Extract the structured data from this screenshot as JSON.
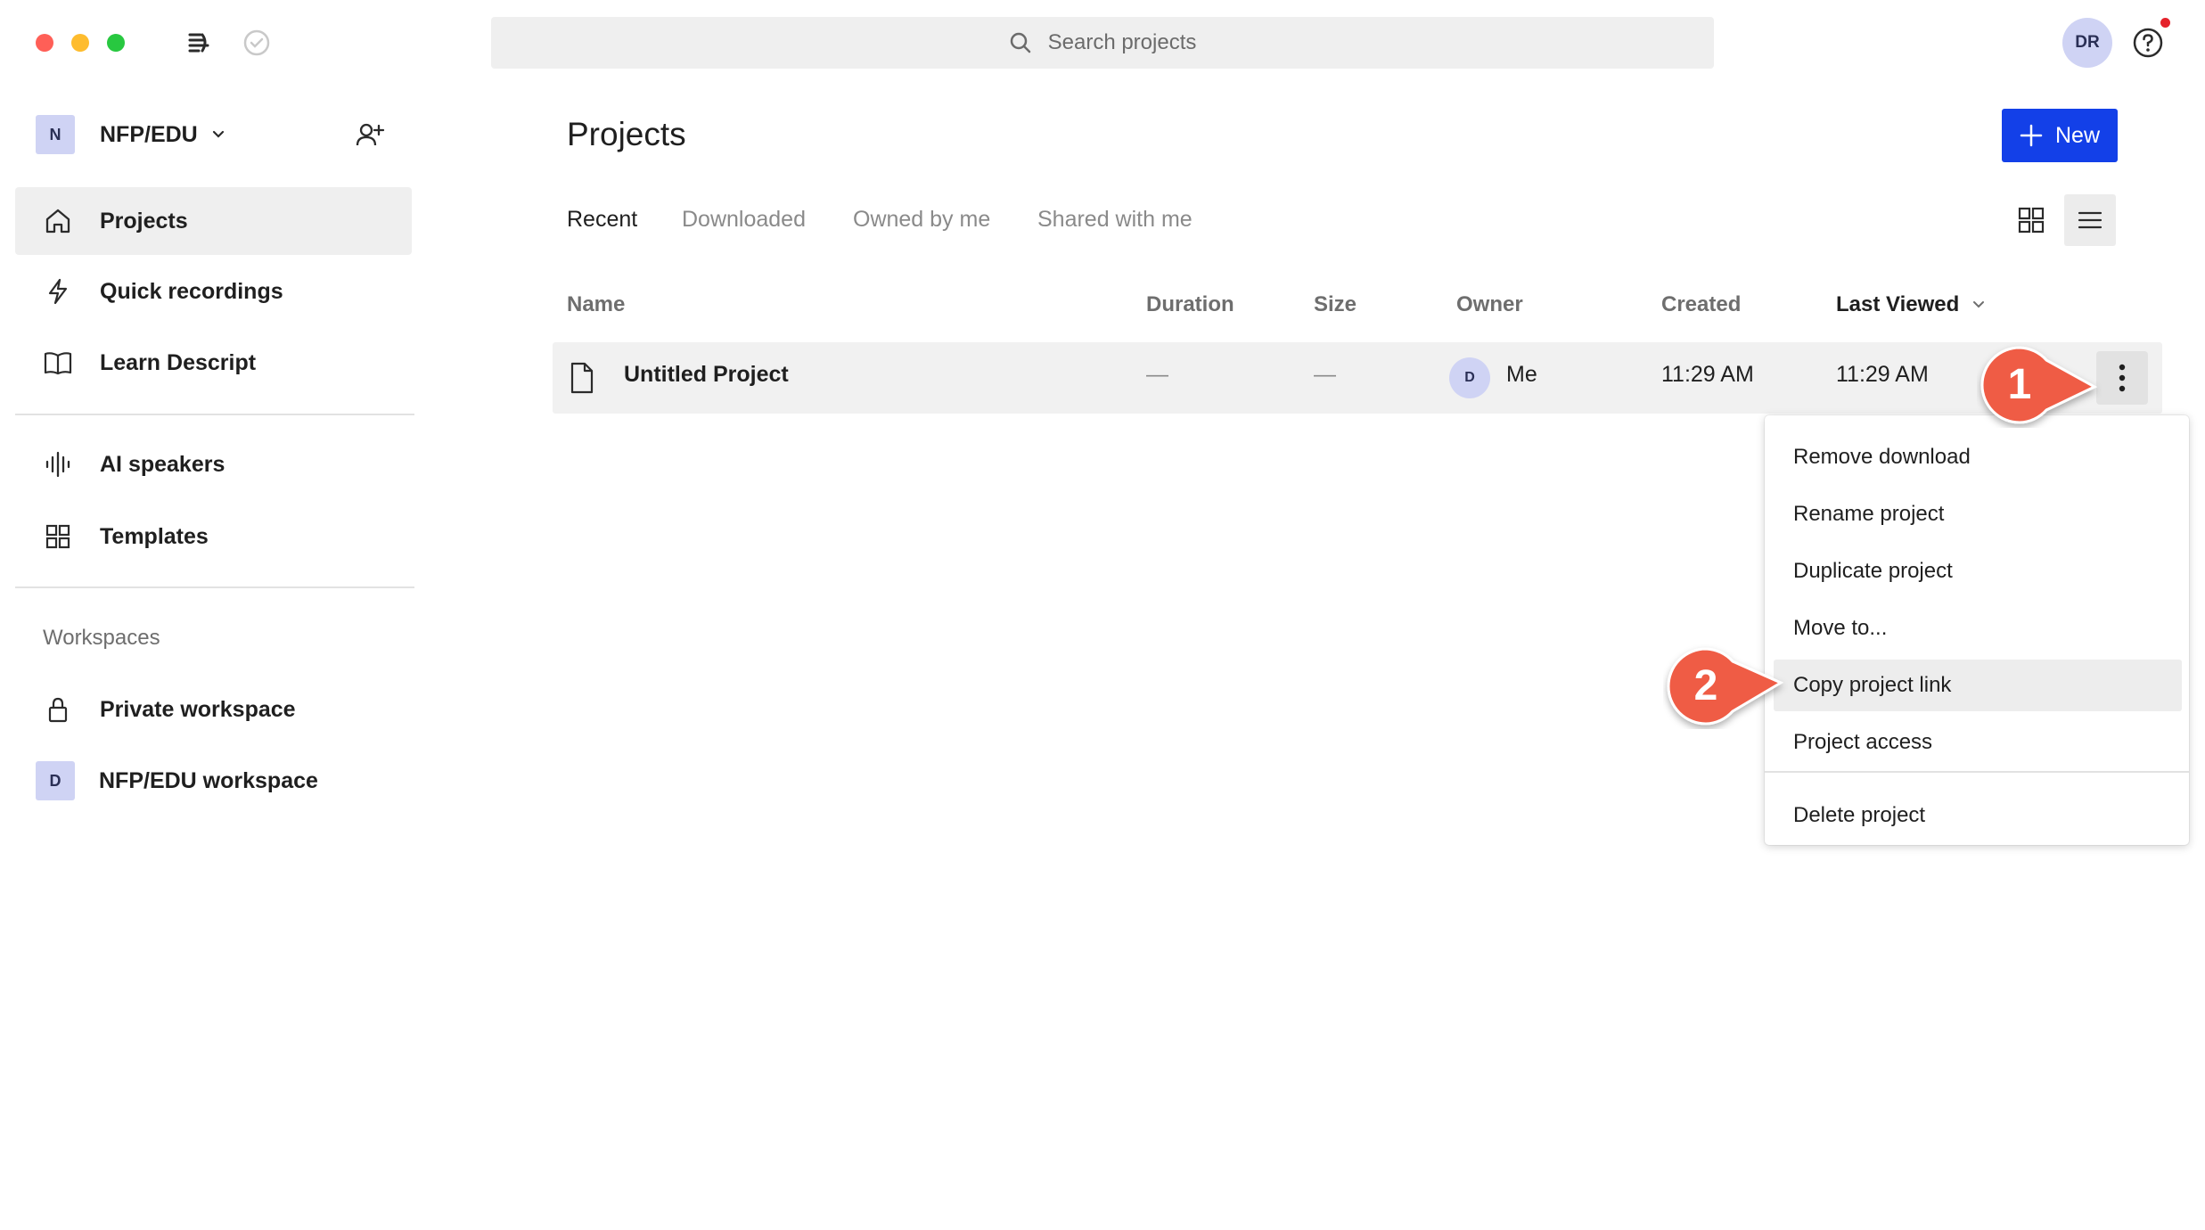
{
  "window": {
    "traffic_lights": {
      "close": "#ff5f57",
      "minimize": "#febc2e",
      "maximize": "#28c840"
    }
  },
  "topbar": {
    "search_placeholder": "Search projects",
    "user_initials": "DR"
  },
  "sidebar": {
    "team": {
      "badge": "N",
      "name": "NFP/EDU"
    },
    "nav": [
      {
        "label": "Projects",
        "icon": "home-icon"
      },
      {
        "label": "Quick recordings",
        "icon": "lightning-icon"
      },
      {
        "label": "Learn Descript",
        "icon": "book-icon"
      }
    ],
    "tools": [
      {
        "label": "AI speakers",
        "icon": "waveform-icon"
      },
      {
        "label": "Templates",
        "icon": "grid-icon"
      }
    ],
    "workspaces_heading": "Workspaces",
    "workspaces": [
      {
        "label": "Private workspace",
        "icon": "lock-icon"
      },
      {
        "label": "NFP/EDU workspace",
        "badge": "D"
      }
    ]
  },
  "main": {
    "title": "Projects",
    "new_button": "New",
    "tabs": [
      "Recent",
      "Downloaded",
      "Owned by me",
      "Shared with me"
    ],
    "columns": [
      "Name",
      "Duration",
      "Size",
      "Owner",
      "Created",
      "Last Viewed"
    ],
    "rows": [
      {
        "name": "Untitled Project",
        "duration": "—",
        "size": "—",
        "owner_initial": "D",
        "owner": "Me",
        "created": "11:29 AM",
        "last_viewed": "11:29 AM"
      }
    ]
  },
  "context_menu": {
    "items": [
      "Remove download",
      "Rename project",
      "Duplicate project",
      "Move to...",
      "Copy project link",
      "Project access"
    ],
    "danger_item": "Delete project"
  },
  "callouts": [
    "1",
    "2"
  ],
  "colors": {
    "accent": "#1340e8",
    "callout": "#ef5b45",
    "avatar": "#cfd3f4"
  }
}
